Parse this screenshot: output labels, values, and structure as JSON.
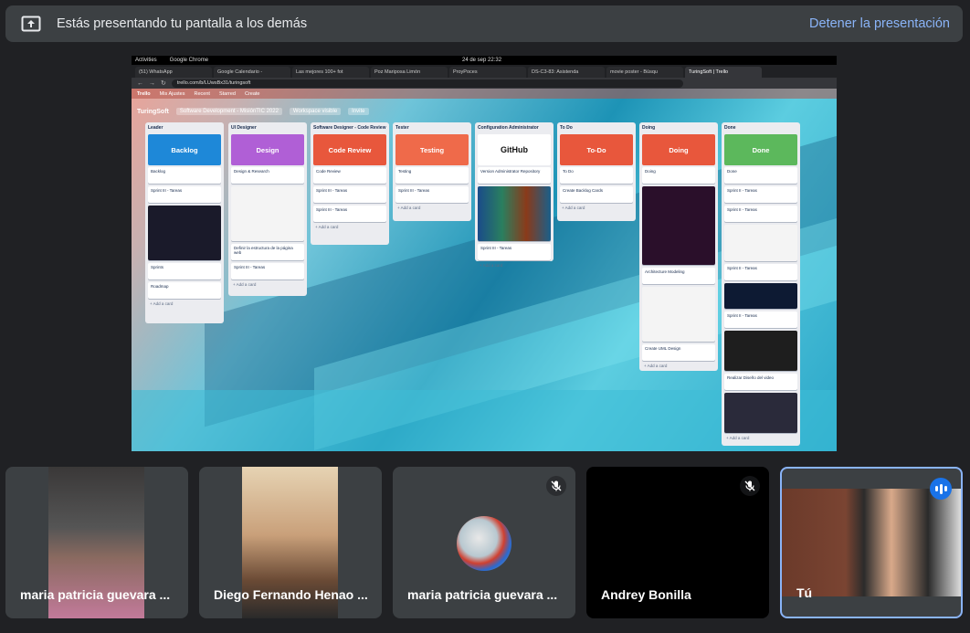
{
  "banner": {
    "text": "Estás presentando tu pantalla a los demás",
    "stop_label": "Detener la presentación"
  },
  "shared_screen": {
    "os_activities": "Activities",
    "os_app": "Google Chrome",
    "os_clock": "24 de sep  22:32",
    "tabs": [
      "(51) WhatsApp",
      "Google Calendario -",
      "Las mejores 100+ fot",
      "Poz Mariposa Limón",
      "ProyPoces",
      "DS-C3-83: Asistenda",
      "movie poster - Búsqu",
      "TuringSoft | Trello"
    ],
    "url": "trello.com/b/LUwsBx31/turingsoft",
    "trello_nav": [
      "Trello",
      "Mis Ajustes",
      "Recent",
      "Starred",
      "Create"
    ],
    "board": {
      "name": "TuringSoft",
      "workspace": "Software Development - MisiónTIC 2022",
      "visibility": "Workspace visible",
      "invite": "Invite",
      "lists": [
        {
          "header": "Leader",
          "cover": "Backlog",
          "cards": [
            "Backlog",
            "Sprint III - Tareas",
            "Sprints",
            "Roadmap"
          ],
          "add": "+ Add a card"
        },
        {
          "header": "UI Designer",
          "cover": "Design",
          "cards": [
            "Design & Research",
            "Definir la estructura de la página web",
            "Sprint III - Tareas"
          ],
          "add": "+ Add a card"
        },
        {
          "header": "Software Designer - Code Review",
          "cover": "Code Review",
          "cards": [
            "Code Review",
            "Sprint III - Tareas",
            "Sprint III - Tareas"
          ],
          "add": "+ Add a card"
        },
        {
          "header": "Tester",
          "cover": "Testing",
          "cards": [
            "Testing",
            "Sprint III - Tareas"
          ],
          "add": "+ Add a card"
        },
        {
          "header": "Configuration Administrator",
          "cover": "GitHub",
          "cards": [
            "Version Administrator Repository",
            "Sprint III - Tareas"
          ],
          "add": "+ Add a card"
        },
        {
          "header": "To Do",
          "cover": "To-Do",
          "cards": [
            "To Do",
            "Create Backlog Cards"
          ],
          "add": "+ Add a card"
        },
        {
          "header": "Doing",
          "cover": "Doing",
          "cards": [
            "Doing",
            "Architecture Modeling",
            "Create UML Design"
          ],
          "add": "+ Add a card"
        },
        {
          "header": "Done",
          "cover": "Done",
          "cards": [
            "Done",
            "Sprint II - Tareas",
            "Sprint II - Tareas",
            "Sprint II - Tareas",
            "Sprint II - Tareas",
            "Realizar Diseño del video"
          ],
          "add": "+ Add a card"
        }
      ]
    }
  },
  "participants": [
    {
      "name": "maria patricia guevara ...",
      "muted": false
    },
    {
      "name": "Diego Fernando Henao ...",
      "muted": false
    },
    {
      "name": "maria patricia guevara ...",
      "muted": true
    },
    {
      "name": "Andrey Bonilla",
      "muted": true
    },
    {
      "name": "Tú",
      "muted": false,
      "speaking": true
    }
  ],
  "colors": {
    "accent": "#8ab4f8",
    "speaking_border": "#8ab4f8",
    "backlog": "#1e88d8",
    "design": "#b05fd6",
    "code_review": "#e8573c",
    "testing": "#ef6a4a",
    "todo": "#e8573c",
    "doing": "#e8573c",
    "done": "#5cb85c"
  }
}
